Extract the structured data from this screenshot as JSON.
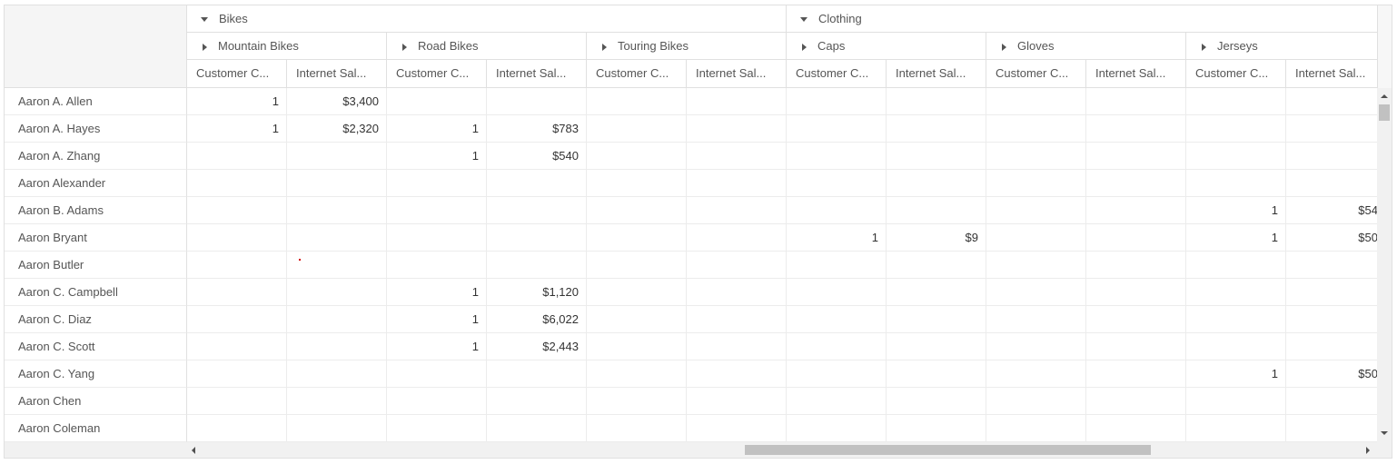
{
  "columns": {
    "categories": [
      {
        "label": "Bikes",
        "expanded": true
      },
      {
        "label": "Clothing",
        "expanded": true
      }
    ],
    "subcategories": [
      {
        "label": "Mountain Bikes",
        "expanded": false
      },
      {
        "label": "Road Bikes",
        "expanded": false
      },
      {
        "label": "Touring Bikes",
        "expanded": false
      },
      {
        "label": "Caps",
        "expanded": false
      },
      {
        "label": "Gloves",
        "expanded": false
      },
      {
        "label": "Jerseys",
        "expanded": false
      }
    ],
    "measures": [
      "Customer C...",
      "Internet Sal...",
      "Customer C...",
      "Internet Sal...",
      "Customer C...",
      "Internet Sal...",
      "Customer C...",
      "Internet Sal...",
      "Customer C...",
      "Internet Sal...",
      "Customer C...",
      "Internet Sal..."
    ]
  },
  "rows": [
    {
      "name": "Aaron A. Allen",
      "cells": [
        "1",
        "$3,400",
        "",
        "",
        "",
        "",
        "",
        "",
        "",
        "",
        "",
        ""
      ]
    },
    {
      "name": "Aaron A. Hayes",
      "cells": [
        "1",
        "$2,320",
        "1",
        "$783",
        "",
        "",
        "",
        "",
        "",
        "",
        "",
        ""
      ]
    },
    {
      "name": "Aaron A. Zhang",
      "cells": [
        "",
        "",
        "1",
        "$540",
        "",
        "",
        "",
        "",
        "",
        "",
        "",
        ""
      ]
    },
    {
      "name": "Aaron Alexander",
      "cells": [
        "",
        "",
        "",
        "",
        "",
        "",
        "",
        "",
        "",
        "",
        "",
        ""
      ]
    },
    {
      "name": "Aaron B. Adams",
      "cells": [
        "",
        "",
        "",
        "",
        "",
        "",
        "",
        "",
        "",
        "",
        "1",
        "$54"
      ]
    },
    {
      "name": "Aaron Bryant",
      "cells": [
        "",
        "",
        "",
        "",
        "",
        "",
        "1",
        "$9",
        "",
        "",
        "1",
        "$50"
      ]
    },
    {
      "name": "Aaron Butler",
      "cells": [
        "",
        "",
        "",
        "",
        "",
        "",
        "",
        "",
        "",
        "",
        "",
        ""
      ]
    },
    {
      "name": "Aaron C. Campbell",
      "cells": [
        "",
        "",
        "1",
        "$1,120",
        "",
        "",
        "",
        "",
        "",
        "",
        "",
        ""
      ]
    },
    {
      "name": "Aaron C. Diaz",
      "cells": [
        "",
        "",
        "1",
        "$6,022",
        "",
        "",
        "",
        "",
        "",
        "",
        "",
        ""
      ]
    },
    {
      "name": "Aaron C. Scott",
      "cells": [
        "",
        "",
        "1",
        "$2,443",
        "",
        "",
        "",
        "",
        "",
        "",
        "",
        ""
      ]
    },
    {
      "name": "Aaron C. Yang",
      "cells": [
        "",
        "",
        "",
        "",
        "",
        "",
        "",
        "",
        "",
        "",
        "1",
        "$50"
      ]
    },
    {
      "name": "Aaron Chen",
      "cells": [
        "",
        "",
        "",
        "",
        "",
        "",
        "",
        "",
        "",
        "",
        "",
        ""
      ]
    },
    {
      "name": "Aaron Coleman",
      "cells": [
        "",
        "",
        "",
        "",
        "",
        "",
        "",
        "",
        "",
        "",
        "",
        ""
      ]
    }
  ],
  "scroll": {
    "horizontal_position": 0.62,
    "vertical_position": 0.02
  },
  "icons": {
    "expanded": "caret-down-icon",
    "collapsed": "caret-right-icon",
    "scroll_left": "arrow-left-icon",
    "scroll_right": "arrow-right-icon",
    "scroll_up": "arrow-up-icon",
    "scroll_down": "arrow-down-icon"
  },
  "colors": {
    "border": "#e0e0e0",
    "header_bg": "#f5f5f5",
    "text": "#555555",
    "scroll_thumb": "#c1c1c1"
  }
}
